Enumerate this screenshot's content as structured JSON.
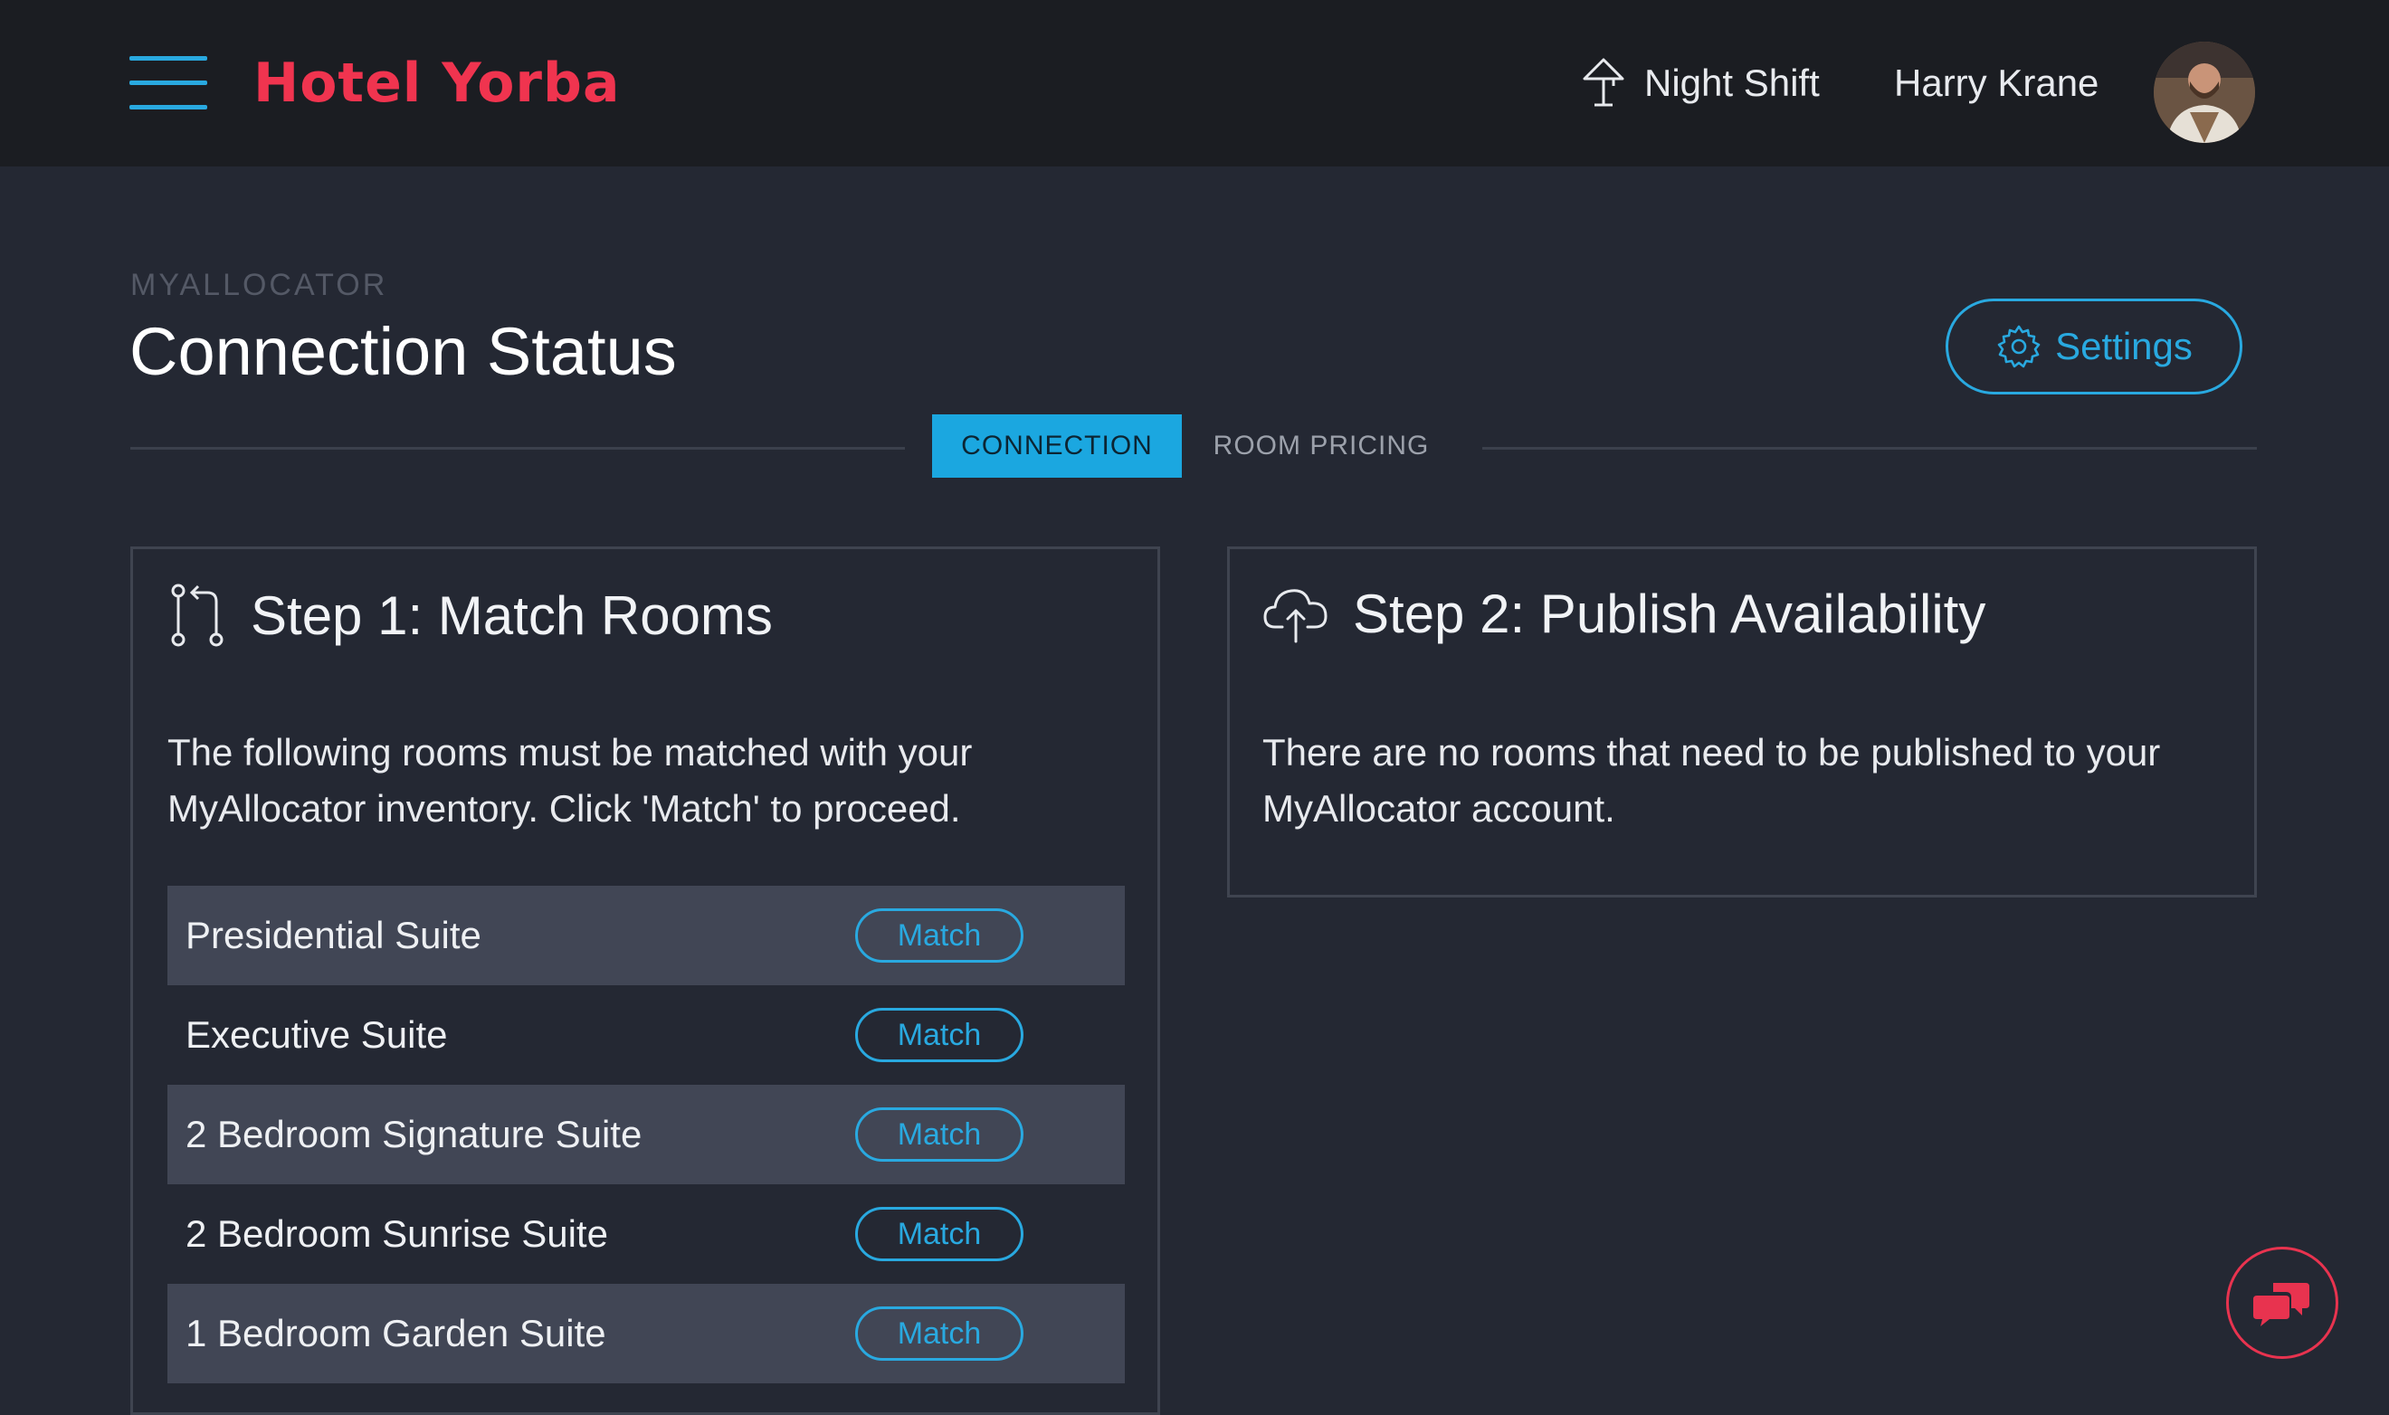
{
  "header": {
    "brand": "Hotel Yorba",
    "shift_label": "Night Shift",
    "user_name": "Harry Krane",
    "accent_color": "#29a9e0",
    "brand_color": "#f0344f"
  },
  "page": {
    "breadcrumb": "MYALLOCATOR",
    "title": "Connection Status",
    "settings_label": "Settings"
  },
  "tabs": [
    {
      "label": "CONNECTION",
      "active": true
    },
    {
      "label": "ROOM PRICING",
      "active": false
    }
  ],
  "step1": {
    "title": "Step 1: Match Rooms",
    "description": "The following rooms must be matched with your MyAllocator inventory. Click 'Match' to proceed.",
    "rooms": [
      {
        "name": "Presidential Suite",
        "action": "Match"
      },
      {
        "name": "Executive Suite",
        "action": "Match"
      },
      {
        "name": "2 Bedroom Signature Suite",
        "action": "Match"
      },
      {
        "name": "2 Bedroom Sunrise Suite",
        "action": "Match"
      },
      {
        "name": "1 Bedroom Garden Suite",
        "action": "Match"
      }
    ]
  },
  "step2": {
    "title": "Step 2: Publish Availability",
    "description": "There are no rooms that need to be published to your MyAllocator account."
  },
  "icons": {
    "menu": "hamburger-menu-icon",
    "shift": "lamp-icon",
    "settings": "gear-icon",
    "step1": "git-compare-icon",
    "step2": "cloud-upload-icon",
    "chat": "chat-bubbles-icon"
  }
}
